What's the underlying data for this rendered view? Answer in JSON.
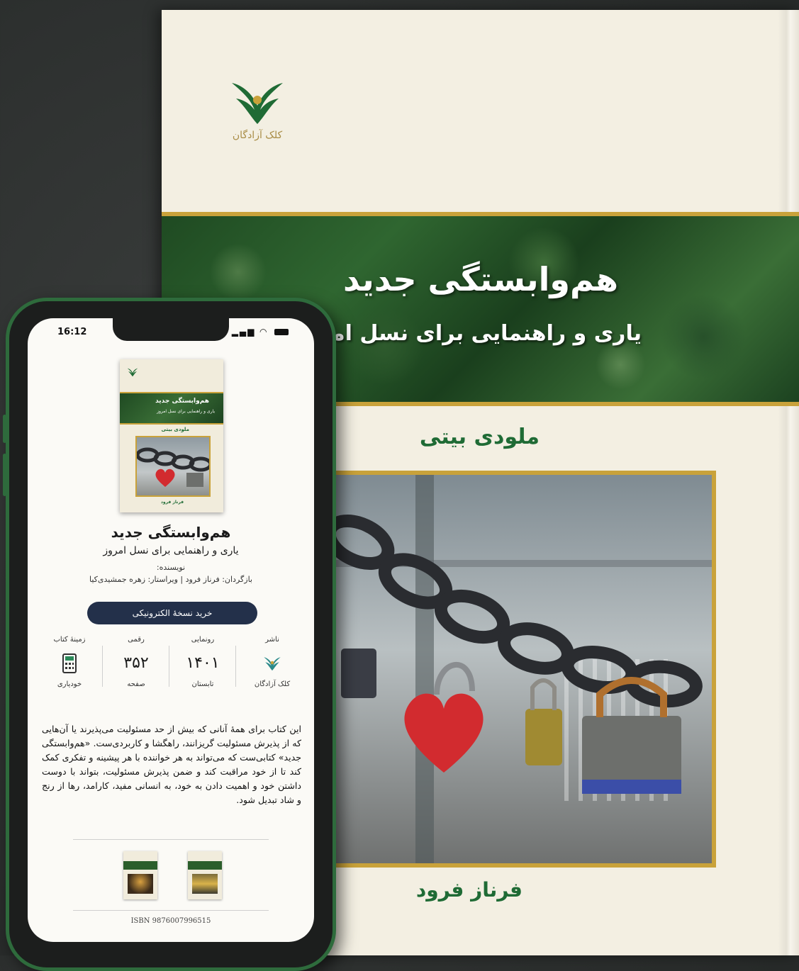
{
  "book": {
    "publisher_logo_text": "کلک آزادگان",
    "title": "هم‌وابستگی جدید",
    "subtitle": "یاری و راهنمایی برای نسل امروز",
    "author": "ملودی بیتی",
    "translator": "فرناز فرود"
  },
  "phone": {
    "status_time": "16:12",
    "mini_cover": {
      "title": "هم‌وابستگی جدید",
      "subtitle": "یاری و راهنمایی برای نسل امروز",
      "author": "ملودی بیتی",
      "translator": "فرناز فرود"
    },
    "title": "هم‌وابستگی جدید",
    "subtitle": "یاری و راهنمایی برای نسل امروز",
    "writer_label": "نویسنده:",
    "credits": "بازگردان: فرناز فرود | ویراستار: زهره جمشیدی‌کیا",
    "buy_button": "خرید نسخهٔ الکترونیکی",
    "info": [
      {
        "label": "ناشر",
        "value": "",
        "icon": "publisher-logo-icon",
        "foot": "کلک آزادگان"
      },
      {
        "label": "رونمایی",
        "value": "۱۴۰۱",
        "foot": "تابستان"
      },
      {
        "label": "رقمی",
        "value": "۳۵۲",
        "foot": "صفحه"
      },
      {
        "label": "زمینهٔ کتاب",
        "value": "",
        "icon": "calculator-icon",
        "foot": "خودیاری"
      }
    ],
    "description": "این کتاب برای همهٔ آنانی که بیش از حد مسئولیت می‌پذیرند یا آن‌هایی که از پذیرش مسئولیت گریزانند، راهگشا و کاربردی‌ست. «هم‌وابستگی جدید» کتابی‌ست که می‌تواند به هر خواننده با هر پیشینه و تفکری کمک کند تا از خود مراقبت کند و ضمن پذیرش مسئولیت، بتواند با دوست داشتن خود و اهمیت دادن به خود، به انسانی مفید، کارامد، رها از رنج و شاد تبدیل شود.",
    "isbn": "ISBN 9876007996515"
  },
  "colors": {
    "green_text": "#1f6b35",
    "gold": "#c9a23a",
    "button": "#23304a"
  }
}
